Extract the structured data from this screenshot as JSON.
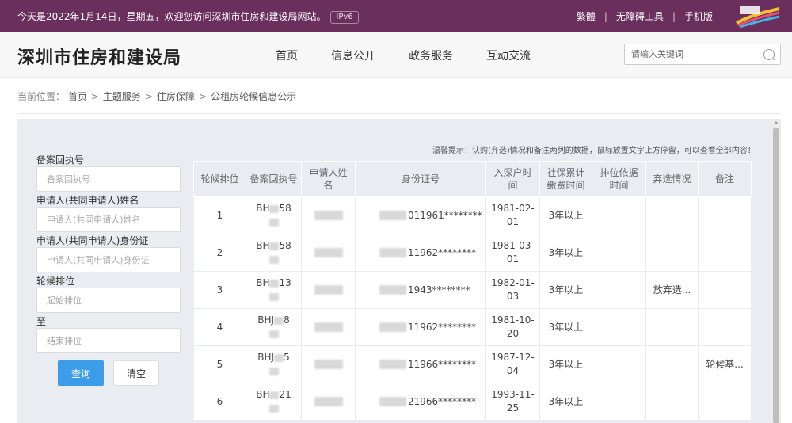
{
  "topbar": {
    "welcome": "今天是2022年1月14日，星期五，欢迎您访问深圳市住房和建设局网站。",
    "ipv6": "IPv6",
    "links": [
      "繁體",
      "无障碍工具",
      "手机版"
    ]
  },
  "header": {
    "title": "深圳市住房和建设局",
    "nav": [
      "首页",
      "信息公开",
      "政务服务",
      "互动交流"
    ],
    "search_placeholder": "请输入关键词"
  },
  "breadcrumb": {
    "label": "当前位置：",
    "items": [
      "首页",
      "主题服务",
      "住房保障",
      "公租房轮候信息公示"
    ]
  },
  "form": {
    "fields": [
      {
        "label": "备案回执号",
        "placeholder": "备案回执号"
      },
      {
        "label": "申请人(共同申请人)姓名",
        "placeholder": "申请人(共同申请人)姓名"
      },
      {
        "label": "申请人(共同申请人)身份证",
        "placeholder": "申请人(共同申请人)身份证"
      },
      {
        "label": "轮候排位",
        "placeholder": "起始排位"
      },
      {
        "label": "至",
        "placeholder": "结束排位"
      }
    ],
    "query": "查询",
    "clear": "清空"
  },
  "tip": "温馨提示：认购(弃选)情况和备注两列的数据，鼠标放置文字上方停留，可以查看全部内容！",
  "table": {
    "headers": [
      "轮候排位",
      "备案回执号",
      "申请人姓名",
      "身份证号",
      "入深户时间",
      "社保累计缴费时间",
      "排位依据时间",
      "弃选情况",
      "备注"
    ],
    "rows": [
      {
        "rank": "1",
        "no_a": "BH",
        "no_b": "58",
        "id": "011961********",
        "hukou": "1981-02-01",
        "social": "3年以上",
        "basis": "",
        "abandon": "",
        "note": ""
      },
      {
        "rank": "2",
        "no_a": "BH",
        "no_b": "58",
        "id": "11962********",
        "hukou": "1981-03-01",
        "social": "3年以上",
        "basis": "",
        "abandon": "",
        "note": ""
      },
      {
        "rank": "3",
        "no_a": "BH",
        "no_b": "13",
        "id": "1943********",
        "hukou": "1982-01-03",
        "social": "3年以上",
        "basis": "",
        "abandon": "放弃选...",
        "note": ""
      },
      {
        "rank": "4",
        "no_a": "BHJ",
        "no_b": "8",
        "id": "11962********",
        "hukou": "1981-10-20",
        "social": "3年以上",
        "basis": "",
        "abandon": "",
        "note": ""
      },
      {
        "rank": "5",
        "no_a": "BHJ",
        "no_b": "5",
        "id": "11966********",
        "hukou": "1987-12-04",
        "social": "3年以上",
        "basis": "",
        "abandon": "",
        "note": "轮候基..."
      },
      {
        "rank": "6",
        "no_a": "BH",
        "no_b": "21",
        "id": "21966********",
        "hukou": "1993-11-25",
        "social": "3年以上",
        "basis": "",
        "abandon": "",
        "note": ""
      }
    ]
  },
  "colors": {
    "topbar_bg": "#6b2f5e",
    "panel_bg": "#e9ecf0",
    "query_button": "#3c9ce8"
  },
  "icons": [
    "search-icon",
    "site-mini-logo"
  ]
}
